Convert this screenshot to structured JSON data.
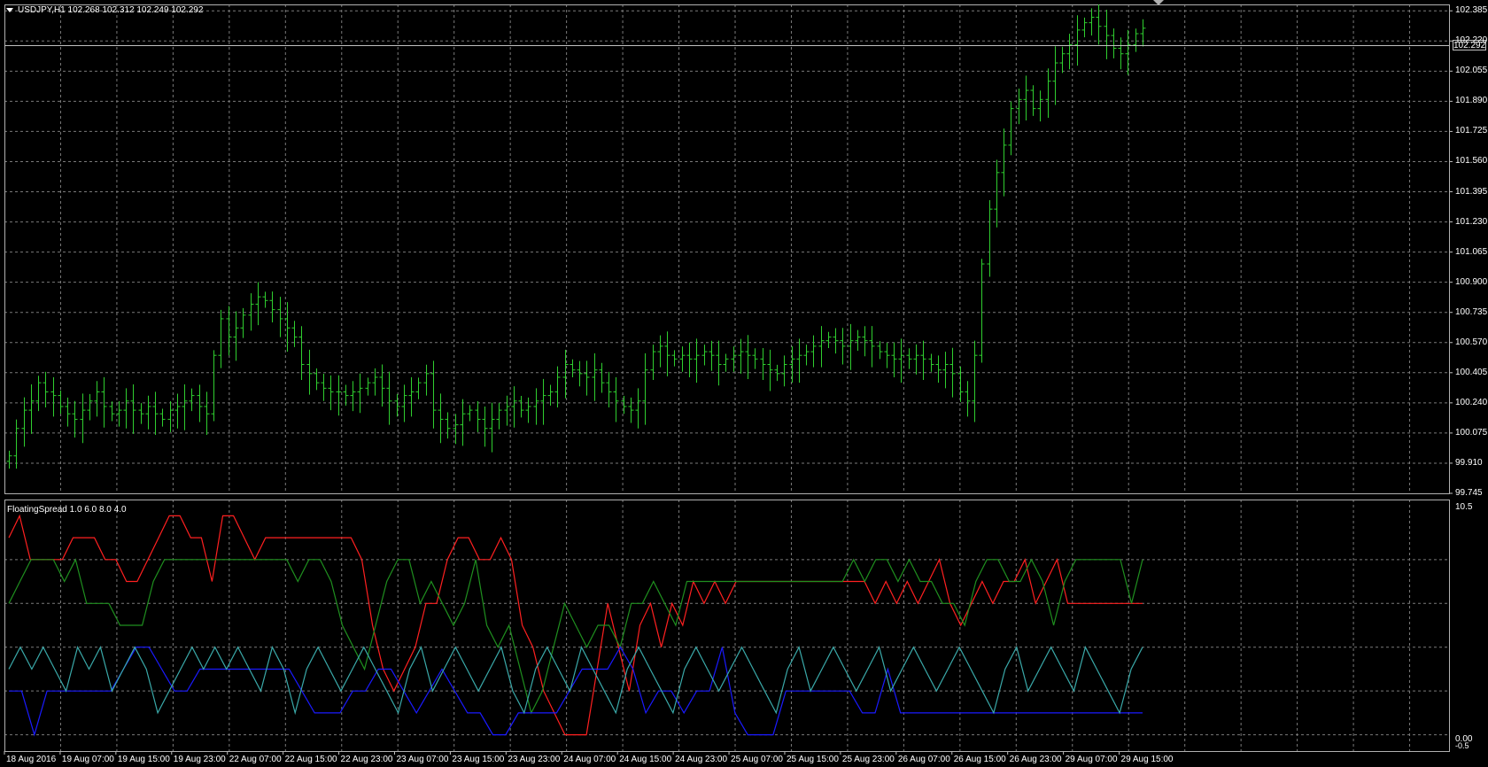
{
  "main_pane": {
    "title": "USDJPY,H1  102.268 102.312 102.249 102.292",
    "current_price": "102.292",
    "price_labels": [
      "102.385",
      "102.220",
      "102.055",
      "101.890",
      "101.725",
      "101.560",
      "101.395",
      "101.230",
      "101.065",
      "100.900",
      "100.735",
      "100.570",
      "100.405",
      "100.240",
      "100.075",
      "99.910",
      "99.745"
    ],
    "colors": {
      "background": "#000000",
      "bars": "#2fce2f",
      "grid": "#7a7a7a",
      "current_line": "#c0c0c0"
    }
  },
  "indicator_pane": {
    "title": "FloatingSpread 1.0 6.0 8.0 4.0",
    "scale_labels": {
      "top": "10.5",
      "zero": "0.00",
      "bottom": "-0.5"
    },
    "colors": {
      "red": "#ff2020",
      "green": "#1f8f1f",
      "blue": "#1a1aff",
      "teal": "#3aa9a9"
    }
  },
  "time_axis": {
    "labels": [
      "18 Aug 2016",
      "19 Aug 07:00",
      "19 Aug 15:00",
      "19 Aug 23:00",
      "22 Aug 07:00",
      "22 Aug 15:00",
      "22 Aug 23:00",
      "23 Aug 07:00",
      "23 Aug 15:00",
      "23 Aug 23:00",
      "24 Aug 07:00",
      "24 Aug 15:00",
      "24 Aug 23:00",
      "25 Aug 07:00",
      "25 Aug 15:00",
      "25 Aug 23:00",
      "26 Aug 07:00",
      "26 Aug 15:00",
      "26 Aug 23:00",
      "29 Aug 07:00",
      "29 Aug 15:00"
    ]
  },
  "chart_data": [
    {
      "type": "ohlc",
      "symbol": "USDJPY",
      "timeframe": "H1",
      "title": "USDJPY,H1  102.268 102.312 102.249 102.292",
      "last_bar": {
        "open": 102.268,
        "high": 102.312,
        "low": 102.249,
        "close": 102.292
      },
      "ylim": [
        99.745,
        102.42
      ],
      "y_ticks": [
        102.385,
        102.22,
        102.055,
        101.89,
        101.725,
        101.56,
        101.395,
        101.23,
        101.065,
        100.9,
        100.735,
        100.57,
        100.405,
        100.24,
        100.075,
        99.91,
        99.745
      ],
      "x_labels": [
        "18 Aug 2016",
        "19 Aug 07:00",
        "19 Aug 15:00",
        "19 Aug 23:00",
        "22 Aug 07:00",
        "22 Aug 15:00",
        "22 Aug 23:00",
        "23 Aug 07:00",
        "23 Aug 15:00",
        "23 Aug 23:00",
        "24 Aug 07:00",
        "24 Aug 15:00",
        "24 Aug 23:00",
        "25 Aug 07:00",
        "25 Aug 15:00",
        "25 Aug 23:00",
        "26 Aug 07:00",
        "26 Aug 15:00",
        "26 Aug 23:00",
        "29 Aug 07:00",
        "29 Aug 15:00"
      ],
      "closes": [
        99.95,
        100.1,
        100.2,
        100.25,
        100.35,
        100.3,
        100.28,
        100.22,
        100.18,
        100.15,
        100.2,
        100.25,
        100.3,
        100.22,
        100.18,
        100.2,
        100.25,
        100.2,
        100.18,
        100.22,
        100.18,
        100.15,
        100.2,
        100.22,
        100.25,
        100.28,
        100.22,
        100.18,
        100.5,
        100.7,
        100.6,
        100.65,
        100.72,
        100.78,
        100.82,
        100.8,
        100.75,
        100.7,
        100.65,
        100.6,
        100.45,
        100.4,
        100.35,
        100.32,
        100.3,
        100.3,
        100.28,
        100.3,
        100.32,
        100.35,
        100.38,
        100.32,
        100.25,
        100.22,
        100.28,
        100.3,
        100.35,
        100.4,
        100.2,
        100.15,
        100.1,
        100.12,
        100.18,
        100.2,
        100.15,
        100.1,
        100.15,
        100.2,
        100.22,
        100.25,
        100.2,
        100.22,
        100.25,
        100.28,
        100.3,
        100.38,
        100.45,
        100.42,
        100.4,
        100.38,
        100.42,
        100.35,
        100.3,
        100.25,
        100.22,
        100.2,
        100.25,
        100.42,
        100.52,
        100.55,
        100.5,
        100.48,
        100.5,
        100.48,
        100.5,
        100.52,
        100.5,
        100.45,
        100.48,
        100.5,
        100.52,
        100.5,
        100.48,
        100.45,
        100.42,
        100.4,
        100.45,
        100.48,
        100.5,
        100.52,
        100.55,
        100.58,
        100.6,
        100.58,
        100.55,
        100.58,
        100.6,
        100.58,
        100.55,
        100.52,
        100.5,
        100.48,
        100.5,
        100.48,
        100.5,
        100.48,
        100.45,
        100.42,
        100.45,
        100.4,
        100.3,
        100.25,
        100.5,
        101.0,
        101.3,
        101.5,
        101.65,
        101.85,
        101.9,
        101.95,
        101.85,
        101.9,
        102.0,
        102.1,
        102.15,
        102.2,
        102.28,
        102.32,
        102.35,
        102.3,
        102.25,
        102.18,
        102.15,
        102.2,
        102.26,
        102.29
      ]
    },
    {
      "type": "line",
      "title": "FloatingSpread 1.0 6.0 8.0 4.0",
      "ylim": [
        -0.5,
        10.5
      ],
      "series": [
        {
          "color": "#ff2020",
          "values": [
            9,
            10,
            8,
            8,
            8,
            8,
            9,
            9,
            9,
            8,
            8,
            7,
            7,
            8,
            9,
            10,
            10,
            9,
            9,
            7,
            10,
            10,
            9,
            8,
            9,
            9,
            9,
            9,
            9,
            9,
            9,
            9,
            9,
            8,
            5,
            3,
            2,
            3,
            4,
            6,
            6,
            8,
            9,
            9,
            8,
            8,
            9,
            8,
            5,
            4,
            2,
            1,
            0,
            0,
            0,
            3,
            6,
            4,
            2,
            5,
            6,
            4,
            6,
            5,
            7,
            6,
            7,
            6,
            7,
            7,
            7,
            7,
            7,
            7,
            7,
            7,
            7,
            7,
            7,
            7,
            7,
            6,
            7,
            6,
            7,
            6,
            7,
            8,
            6,
            5,
            6,
            7,
            6,
            7,
            7,
            8,
            6,
            7,
            8,
            6,
            6,
            6,
            6,
            6,
            6,
            6,
            6
          ]
        },
        {
          "color": "#1f8f1f",
          "values": [
            6,
            7,
            8,
            8,
            8,
            7,
            8,
            6,
            6,
            6,
            5,
            5,
            5,
            7,
            8,
            8,
            8,
            8,
            8,
            8,
            8,
            8,
            8,
            8,
            8,
            8,
            7,
            8,
            8,
            7,
            5,
            4,
            3,
            5,
            7,
            8,
            8,
            6,
            7,
            6,
            5,
            6,
            8,
            5,
            4,
            5,
            3,
            1,
            2,
            4,
            6,
            5,
            4,
            5,
            5,
            4,
            6,
            6,
            7,
            6,
            5,
            7,
            7,
            7,
            7,
            7,
            7,
            7,
            7,
            7,
            7,
            7,
            7,
            7,
            7,
            7,
            8,
            7,
            8,
            8,
            7,
            8,
            7,
            7,
            6,
            6,
            5,
            7,
            8,
            8,
            7,
            7,
            8,
            7,
            5,
            7,
            8,
            8,
            8,
            8,
            8,
            6,
            8
          ]
        },
        {
          "color": "#1a1aff",
          "values": [
            2,
            2,
            0,
            2,
            2,
            2,
            2,
            2,
            2,
            3,
            4,
            4,
            3,
            2,
            2,
            3,
            3,
            3,
            3,
            3,
            3,
            3,
            3,
            2,
            1,
            1,
            1,
            2,
            2,
            3,
            3,
            2,
            1,
            2,
            3,
            2,
            1,
            1,
            0,
            0,
            1,
            1,
            1,
            1,
            2,
            3,
            3,
            3,
            4,
            3,
            1,
            2,
            2,
            1,
            2,
            2,
            4,
            1,
            0,
            0,
            0,
            2,
            2,
            2,
            2,
            2,
            2,
            1,
            1,
            3,
            1,
            1,
            1,
            1,
            1,
            1,
            1,
            1,
            1,
            1,
            1,
            1,
            1,
            1,
            1,
            1,
            1,
            1,
            1,
            1
          ]
        },
        {
          "color": "#3aa9a9",
          "values": [
            3,
            4,
            3,
            4,
            3,
            2,
            4,
            3,
            4,
            2,
            3,
            4,
            3,
            1,
            2,
            3,
            4,
            3,
            4,
            3,
            4,
            3,
            2,
            4,
            3,
            1,
            3,
            4,
            3,
            2,
            3,
            4,
            3,
            2,
            1,
            3,
            4,
            2,
            3,
            4,
            3,
            2,
            3,
            4,
            2,
            1,
            3,
            4,
            3,
            2,
            4,
            3,
            2,
            1,
            3,
            4,
            3,
            2,
            1,
            3,
            4,
            3,
            2,
            3,
            4,
            3,
            2,
            1,
            3,
            4,
            2,
            3,
            4,
            3,
            2,
            3,
            4,
            2,
            3,
            4,
            3,
            2,
            3,
            4,
            3,
            2,
            1,
            3,
            4,
            2,
            3,
            4,
            3,
            2,
            4,
            3,
            2,
            1,
            3,
            4
          ]
        }
      ]
    }
  ]
}
